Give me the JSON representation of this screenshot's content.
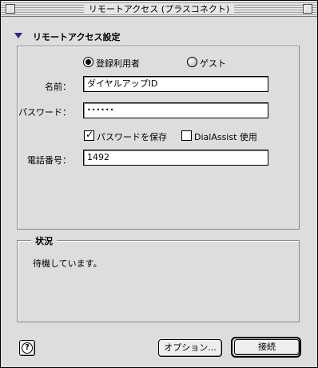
{
  "window": {
    "title": "リモートアクセス (プラスコネクト)"
  },
  "section": {
    "title": "リモートアクセス設定"
  },
  "user_type": {
    "options": [
      {
        "label": "登録利用者",
        "selected": true
      },
      {
        "label": "ゲスト",
        "selected": false
      }
    ]
  },
  "fields": {
    "name": {
      "label": "名前：",
      "value": "ダイヤルアップID"
    },
    "password": {
      "label": "パスワード：",
      "value": "••••••"
    },
    "phone": {
      "label": "電話番号：",
      "value": "1492"
    }
  },
  "checkboxes": {
    "save_password": {
      "label": "パスワードを保存",
      "checked": true
    },
    "dialassist": {
      "label": "DialAssist 使用",
      "checked": false
    }
  },
  "status": {
    "title": "状況",
    "message": "待機しています。"
  },
  "buttons": {
    "help": "?",
    "options": "オプション...",
    "connect": "接続"
  },
  "icons": {
    "disclosure": "disclosure-triangle-down-icon"
  }
}
